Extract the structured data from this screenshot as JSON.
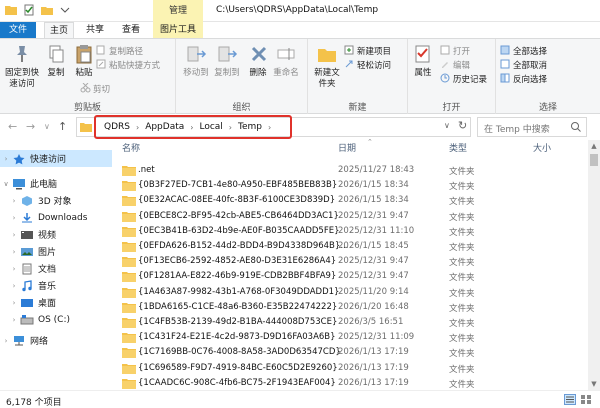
{
  "title_bar": {
    "manage_tab": "管理",
    "path": "C:\\Users\\QDRS\\AppData\\Local\\Temp"
  },
  "tabs": [
    "文件",
    "主页",
    "共享",
    "查看",
    "图片工具"
  ],
  "ribbon": {
    "clipboard": {
      "pin_label": "固定到快速访问",
      "copy_label": "复制",
      "paste_label": "粘贴",
      "cut_label": "剪切",
      "copy_path_label": "复制路径",
      "paste_shortcut_label": "粘贴快捷方式",
      "group_label": "剪贴板"
    },
    "organize": {
      "move_to_label": "移动到",
      "copy_to_label": "复制到",
      "delete_label": "删除",
      "rename_label": "重命名",
      "group_label": "组织"
    },
    "new": {
      "new_folder_label": "新建文件夹",
      "new_item_label": "新建项目",
      "easy_access_label": "轻松访问",
      "group_label": "新建"
    },
    "open": {
      "properties_label": "属性",
      "open_label": "打开",
      "edit_label": "编辑",
      "history_label": "历史记录",
      "group_label": "打开"
    },
    "select": {
      "select_all_label": "全部选择",
      "select_none_label": "全部取消",
      "invert_label": "反向选择",
      "group_label": "选择"
    }
  },
  "breadcrumbs": [
    "QDRS",
    "AppData",
    "Local",
    "Temp"
  ],
  "search": {
    "placeholder": "在 Temp 中搜索"
  },
  "nav_pane": {
    "items": [
      {
        "label": "快速访问",
        "selected": true
      },
      {
        "label": "此电脑"
      },
      {
        "label": "3D 对象"
      },
      {
        "label": "Downloads"
      },
      {
        "label": "视频"
      },
      {
        "label": "图片"
      },
      {
        "label": "文档"
      },
      {
        "label": "音乐"
      },
      {
        "label": "桌面"
      },
      {
        "label": "OS (C:)"
      },
      {
        "label": "网络"
      }
    ]
  },
  "columns": {
    "name": "名称",
    "date": "日期",
    "type": "类型",
    "size": "大小"
  },
  "files": [
    {
      "name": ".net",
      "date": "2025/11/27 18:43",
      "type": "文件夹"
    },
    {
      "name": "{0B3F27ED-7CB1-4e80-A950-EBF485BEB83B}",
      "date": "2026/1/15 18:34",
      "type": "文件夹"
    },
    {
      "name": "{0E32ACAC-08EE-40fc-8B3F-6100CE3D839D}",
      "date": "2026/1/15 18:34",
      "type": "文件夹"
    },
    {
      "name": "{0EBCE8C2-BF95-42cb-ABE5-CB6464DD3AC1}",
      "date": "2025/12/31 9:47",
      "type": "文件夹"
    },
    {
      "name": "{0EC3B41B-63D2-4b9e-AE0F-B035CAADD5FE}",
      "date": "2025/12/31 11:10",
      "type": "文件夹"
    },
    {
      "name": "{0EFDA626-B152-44d2-BDD4-B9D4338D964B}...",
      "date": "2026/1/15 18:45",
      "type": "文件夹"
    },
    {
      "name": "{0F13ECB6-2592-4852-AE80-D3E31E6286A4}",
      "date": "2025/12/31 9:47",
      "type": "文件夹"
    },
    {
      "name": "{0F1281AA-E822-46b9-919E-CDB2BBF4BFA9}",
      "date": "2025/12/31 9:47",
      "type": "文件夹"
    },
    {
      "name": "{1A463A87-9982-43b1-A768-0F3049DDADD1}",
      "date": "2025/11/20 9:14",
      "type": "文件夹"
    },
    {
      "name": "{1BDA6165-C1CE-48a6-B360-E35B22474222}",
      "date": "2026/1/20 16:48",
      "type": "文件夹"
    },
    {
      "name": "{1C4FB53B-2139-49d2-B1BA-444008D753CE}",
      "date": "2026/3/5 16:51",
      "type": "文件夹"
    },
    {
      "name": "{1C431F24-E21E-4c2d-9873-D9D16FA03A6B}",
      "date": "2025/12/31 11:09",
      "type": "文件夹"
    },
    {
      "name": "{1C7169BB-0C76-4008-8A58-3AD0D63547CD}",
      "date": "2026/1/13 17:19",
      "type": "文件夹"
    },
    {
      "name": "{1C696589-F9D7-4919-84BC-E60C5D2E9260}",
      "date": "2026/1/13 17:19",
      "type": "文件夹"
    },
    {
      "name": "{1CAADC6C-908C-4fb6-BC75-2F1943EAF004}",
      "date": "2026/1/13 17:19",
      "type": "文件夹"
    }
  ],
  "status": {
    "count": "6,178 个项目"
  },
  "colors": {
    "accent": "#1979ca",
    "folder": "#f4c24a",
    "highlight": "#e0322b",
    "selected": "#cce8ff"
  }
}
